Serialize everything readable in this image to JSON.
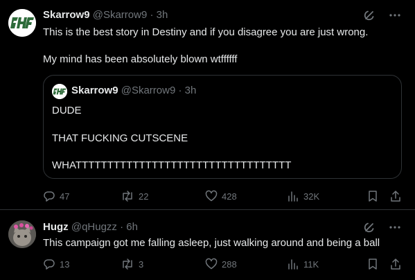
{
  "colors": {
    "background": "#000000",
    "text": "#e7e9ea",
    "muted": "#71767b",
    "border": "#2f3336"
  },
  "tweets": [
    {
      "name": "Skarrow9",
      "handle": "@Skarrow9",
      "separator": "·",
      "time": "3h",
      "lines": [
        "This is the best story in Destiny and if you disagree you are just wrong.",
        "My mind has been absolutely blown wtffffff"
      ],
      "header_icons": [
        "grok-icon",
        "more-icon"
      ],
      "quote": {
        "name": "Skarrow9",
        "handle": "@Skarrow9",
        "separator": "·",
        "time": "3h",
        "lines": [
          "DUDE",
          "THAT FUCKING CUTSCENE",
          "WHATTTTTTTTTTTTTTTTTTTTTTTTTTTTTTTTTT"
        ]
      },
      "actions": {
        "replies": "47",
        "reposts": "22",
        "likes": "428",
        "views": "32K"
      }
    },
    {
      "name": "Hugz",
      "handle": "@qHugzz",
      "separator": "·",
      "time": "6h",
      "lines": [
        "This campaign got me falling asleep, just walking around and being a ball"
      ],
      "header_icons": [
        "grok-icon",
        "more-icon"
      ],
      "actions": {
        "replies": "13",
        "reposts": "3",
        "likes": "288",
        "views": "11K"
      }
    }
  ]
}
